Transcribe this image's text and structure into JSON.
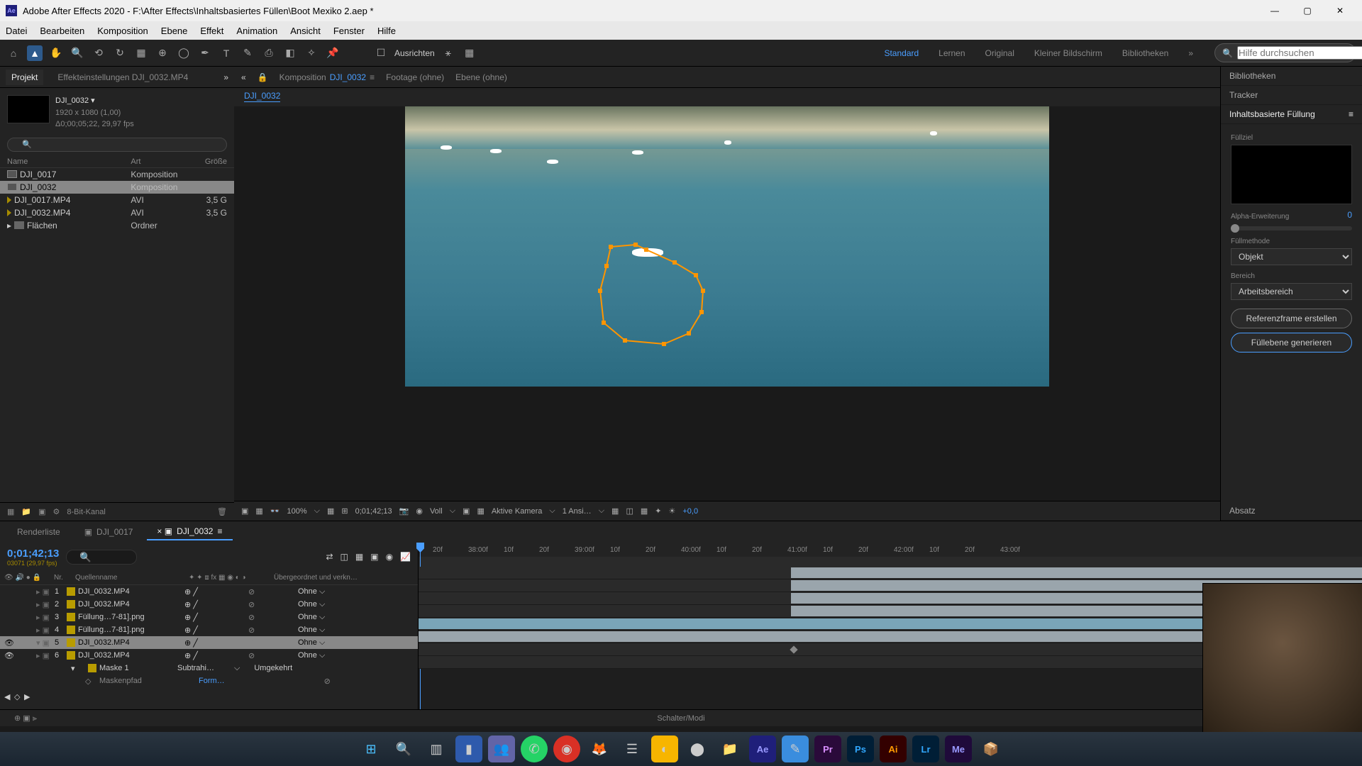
{
  "title": "Adobe After Effects 2020 - F:\\After Effects\\Inhaltsbasiertes Füllen\\Boot Mexiko 2.aep *",
  "menu": [
    "Datei",
    "Bearbeiten",
    "Komposition",
    "Ebene",
    "Effekt",
    "Animation",
    "Ansicht",
    "Fenster",
    "Hilfe"
  ],
  "toolbar": {
    "align": "Ausrichten",
    "offset": "+0,0"
  },
  "workspaces": [
    "Standard",
    "Lernen",
    "Original",
    "Kleiner Bildschirm",
    "Bibliotheken"
  ],
  "search_placeholder": "Hilfe durchsuchen",
  "project": {
    "tab": "Projekt",
    "effects_tab": "Effekteinstellungen  DJI_0032.MP4",
    "comp_name": "DJI_0032",
    "dims": "1920 x 1080 (1,00)",
    "dur": "Δ0;00;05;22, 29,97 fps",
    "cols": {
      "name": "Name",
      "type": "Art",
      "size": "Größe"
    },
    "items": [
      {
        "name": "DJI_0017",
        "type": "Komposition",
        "size": "",
        "kind": "comp"
      },
      {
        "name": "DJI_0032",
        "type": "Komposition",
        "size": "",
        "kind": "comp",
        "sel": true
      },
      {
        "name": "DJI_0017.MP4",
        "type": "AVI",
        "size": "3,5 G",
        "kind": "vid"
      },
      {
        "name": "DJI_0032.MP4",
        "type": "AVI",
        "size": "3,5 G",
        "kind": "vid"
      },
      {
        "name": "Flächen",
        "type": "Ordner",
        "size": "",
        "kind": "fold"
      }
    ],
    "depth": "8-Bit-Kanal"
  },
  "composition": {
    "label": "Komposition",
    "name": "DJI_0032",
    "footage_tab": "Footage  (ohne)",
    "layer_tab": "Ebene  (ohne)",
    "zoom": "100%",
    "timecode": "0;01;42;13",
    "res": "Voll",
    "camera": "Aktive Kamera",
    "views": "1 Ansi…",
    "exposure": "+0,0"
  },
  "right_panel": {
    "tabs": [
      "Bibliotheken",
      "Tracker",
      "Inhaltsbasierte Füllung"
    ],
    "fill": {
      "target": "Füllziel",
      "alpha": "Alpha-Erweiterung",
      "alpha_val": "0",
      "method_label": "Füllmethode",
      "method": "Objekt",
      "range_label": "Bereich",
      "range": "Arbeitsbereich",
      "ref_btn": "Referenzframe erstellen",
      "gen_btn": "Füllebene generieren"
    },
    "absatz": "Absatz"
  },
  "timeline": {
    "render": "Renderliste",
    "tabs": [
      {
        "name": "DJI_0017"
      },
      {
        "name": "DJI_0032",
        "active": true
      }
    ],
    "timecode": "0;01;42;13",
    "frames": "03071 (29,97 fps)",
    "col_nr": "Nr.",
    "col_src": "Quellenname",
    "col_parent": "Übergeordnet und verkn…",
    "ruler": [
      "20f",
      "38:00f",
      "10f",
      "20f",
      "39:00f",
      "10f",
      "20f",
      "40:00f",
      "10f",
      "20f",
      "41:00f",
      "10f",
      "20f",
      "42:00f",
      "10f",
      "20f",
      "43:00f"
    ],
    "layers": [
      {
        "n": "1",
        "name": "DJI_0032.MP4",
        "parent": "Ohne"
      },
      {
        "n": "2",
        "name": "DJI_0032.MP4",
        "parent": "Ohne"
      },
      {
        "n": "3",
        "name": "Füllung…7-81].png",
        "parent": "Ohne"
      },
      {
        "n": "4",
        "name": "Füllung…7-81].png",
        "parent": "Ohne"
      },
      {
        "n": "5",
        "name": "DJI_0032.MP4",
        "parent": "Ohne",
        "sel": true
      },
      {
        "n": "6",
        "name": "DJI_0032.MP4",
        "parent": "Ohne"
      }
    ],
    "mask": {
      "name": "Maske 1",
      "mode": "Subtrahi…",
      "invert": "Umgekehrt",
      "path_label": "Maskenpfad",
      "path_val": "Form…"
    },
    "footer": "Schalter/Modi"
  }
}
